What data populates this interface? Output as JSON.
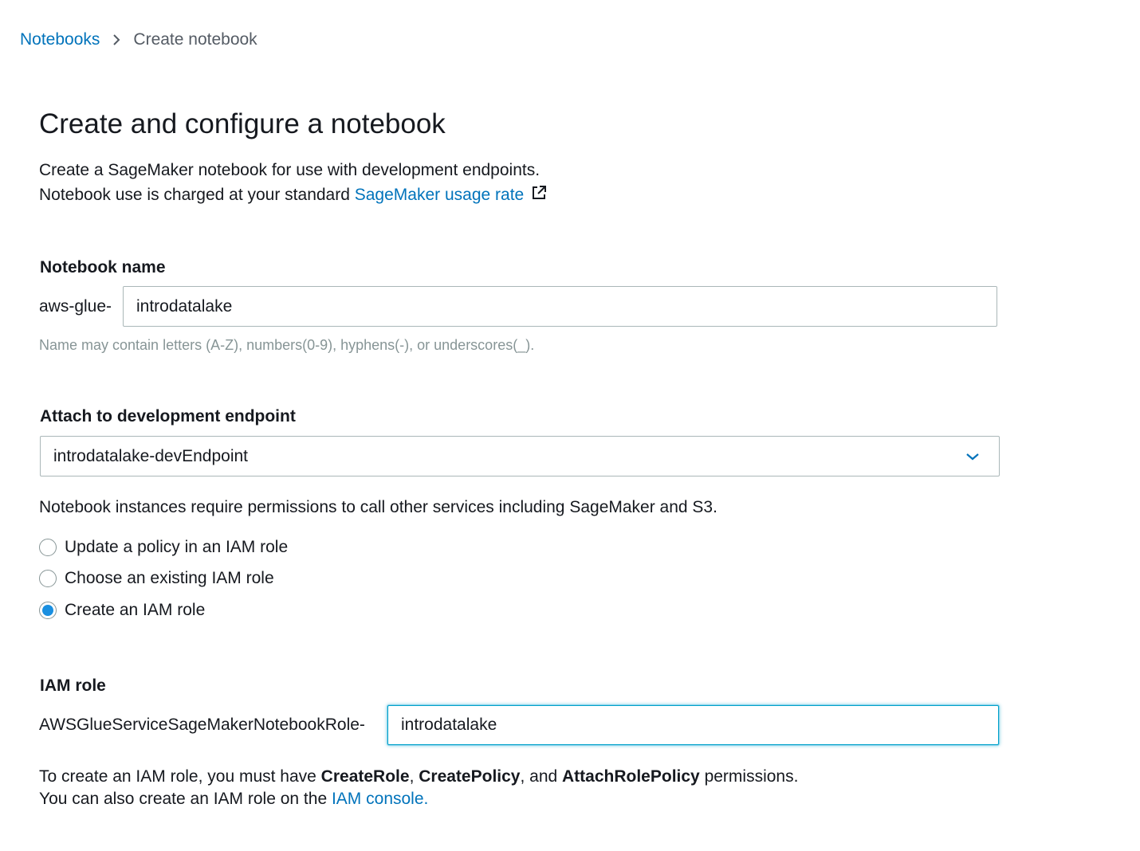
{
  "breadcrumb": {
    "parent": "Notebooks",
    "current": "Create notebook"
  },
  "page": {
    "title": "Create and configure a notebook",
    "description_line1": "Create a SageMaker notebook for use with development endpoints.",
    "description_line2_prefix": "Notebook use is charged at your standard ",
    "usage_rate_link": "SageMaker usage rate"
  },
  "notebook_name": {
    "label": "Notebook name",
    "prefix": "aws-glue-",
    "value": "introdatalake",
    "hint": "Name may contain letters (A-Z), numbers(0-9), hyphens(-), or underscores(_)."
  },
  "endpoint": {
    "label": "Attach to development endpoint",
    "selected": "introdatalake-devEndpoint"
  },
  "permissions": {
    "note": "Notebook instances require permissions to call other services including SageMaker and S3.",
    "options": [
      {
        "label": "Update a policy in an IAM role",
        "checked": false
      },
      {
        "label": "Choose an existing IAM role",
        "checked": false
      },
      {
        "label": "Create an IAM role",
        "checked": true
      }
    ]
  },
  "iam_role": {
    "label": "IAM role",
    "prefix": "AWSGlueServiceSageMakerNotebookRole-",
    "value": "introdatalake",
    "info_prefix": "To create an IAM role, you must have ",
    "perm1": "CreateRole",
    "sep1": ", ",
    "perm2": "CreatePolicy",
    "sep2": ", and ",
    "perm3": "AttachRolePolicy",
    "info_suffix": " permissions.",
    "console_prefix": "You can also create an IAM role on the ",
    "console_link": "IAM console."
  },
  "icons": {
    "breadcrumb_separator": "chevron-right-icon",
    "external_link": "external-link-icon",
    "dropdown": "chevron-down-icon"
  },
  "colors": {
    "link": "#0073bb",
    "radio_selected": "#1a8fe0",
    "focus_border": "#00a1c9",
    "hint_text": "#879596"
  }
}
